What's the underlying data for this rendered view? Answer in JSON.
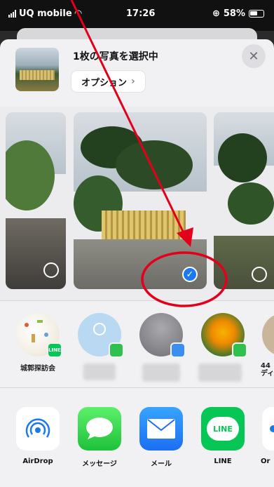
{
  "status_bar": {
    "carrier": "UQ mobile",
    "time": "17:26",
    "battery": "58%"
  },
  "header": {
    "title": "1枚の写真を選択中",
    "options_label": "オプション",
    "close_glyph": "✕"
  },
  "photos": [
    {
      "id": "left",
      "selected": false
    },
    {
      "id": "center",
      "selected": true,
      "check": "✓"
    },
    {
      "id": "right",
      "selected": false
    }
  ],
  "people": [
    {
      "name": "城郭探訪会",
      "badge": "LINE"
    },
    {
      "name": "",
      "badge": ""
    },
    {
      "name": "",
      "badge": ""
    },
    {
      "name": "",
      "badge": ""
    },
    {
      "name": "44\nディ",
      "badge": ""
    }
  ],
  "apps": [
    {
      "label": "AirDrop",
      "icon": "airdrop-icon"
    },
    {
      "label": "メッセージ",
      "icon": "messages-icon"
    },
    {
      "label": "メール",
      "icon": "mail-icon"
    },
    {
      "label": "LINE",
      "icon": "line-icon",
      "icon_text": "LINE"
    },
    {
      "label": "Or",
      "icon": "other-icon"
    }
  ],
  "colors": {
    "annotation": "#e3001b",
    "selected": "#1a78f2",
    "line_green": "#06c755"
  }
}
